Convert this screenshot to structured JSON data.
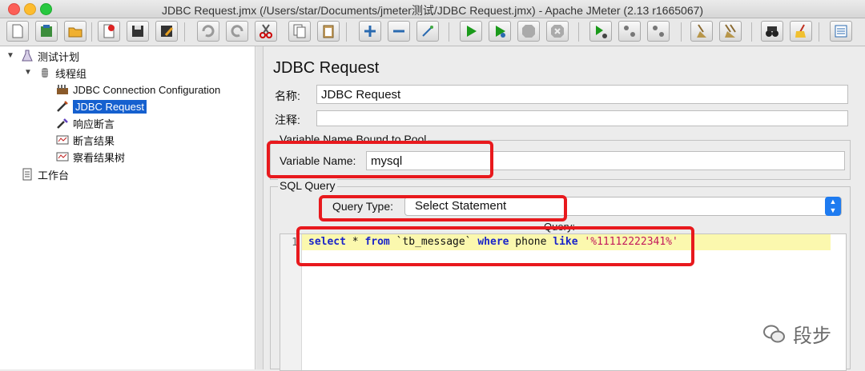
{
  "window": {
    "title": "JDBC Request.jmx (/Users/star/Documents/jmeter测试/JDBC Request.jmx) - Apache JMeter (2.13 r1665067)"
  },
  "tree": {
    "items": [
      {
        "label": "测试计划",
        "icon": "test-plan-icon"
      },
      {
        "label": "线程组",
        "icon": "thread-group-icon"
      },
      {
        "label": "JDBC Connection Configuration",
        "icon": "config-element-icon"
      },
      {
        "label": "JDBC Request",
        "icon": "sampler-pen-icon",
        "selected": true
      },
      {
        "label": "响应断言",
        "icon": "assertion-icon"
      },
      {
        "label": "断言结果",
        "icon": "listener-icon"
      },
      {
        "label": "察看结果树",
        "icon": "listener-icon"
      },
      {
        "label": "工作台",
        "icon": "workbench-icon"
      }
    ]
  },
  "panel": {
    "title": "JDBC Request",
    "name_label": "名称:",
    "name_value": "JDBC Request",
    "comment_label": "注释:",
    "comment_value": "",
    "pool_legend": "Variable Name Bound to Pool",
    "variable_label": "Variable Name:",
    "variable_value": "mysql",
    "sql_legend": "SQL Query",
    "query_type_label": "Query Type:",
    "query_type_value": "Select Statement",
    "query_label": "Query:",
    "line_number": "1",
    "query_parts": {
      "kw1": "select",
      "op": " * ",
      "kw2": "from",
      "table": " `tb_message` ",
      "kw3": "where",
      "col": " phone ",
      "kw4": "like",
      "sp": " ",
      "literal": "'%11112222341%'"
    }
  },
  "watermark": {
    "text": "段步"
  },
  "colors": {
    "highlight": "#e8191d",
    "selection": "#1560cf",
    "keyword": "#1a24c9",
    "string": "#c2185b"
  }
}
